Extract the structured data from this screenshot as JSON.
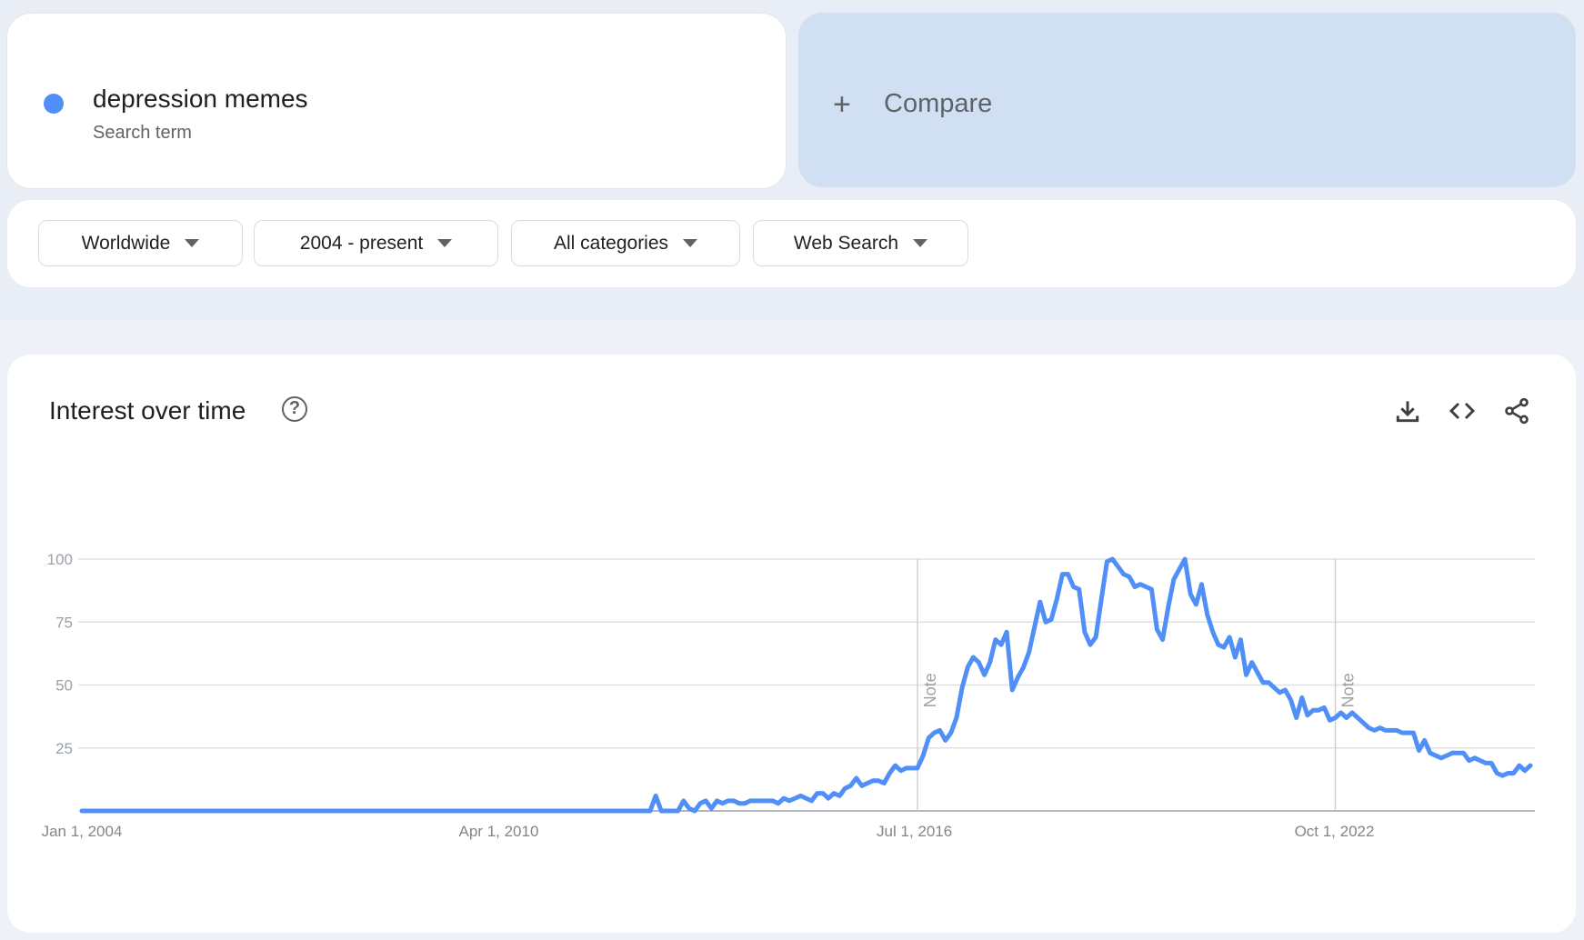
{
  "search_term": {
    "name": "depression memes",
    "subtitle": "Search term",
    "color": "#4f8ff7"
  },
  "compare": {
    "plus_icon": "+",
    "label": "Compare"
  },
  "filters": [
    {
      "label": "Worldwide"
    },
    {
      "label": "2004 - present"
    },
    {
      "label": "All categories"
    },
    {
      "label": "Web Search"
    }
  ],
  "chart_card": {
    "title": "Interest over time",
    "help_icon": "?",
    "actions": [
      "download-icon",
      "embed-code-icon",
      "share-icon"
    ]
  },
  "chart_data": {
    "type": "line",
    "title": "Interest over time",
    "xlabel": "",
    "ylabel": "",
    "ylim": [
      0,
      100
    ],
    "yticks": [
      25,
      50,
      75,
      100
    ],
    "x_start": "2004-01",
    "x_interval": "month",
    "x_tick_labels": [
      {
        "label": "Jan 1, 2004",
        "month_index": 0
      },
      {
        "label": "Apr 1, 2010",
        "month_index": 75
      },
      {
        "label": "Jul 1, 2016",
        "month_index": 150
      },
      {
        "label": "Oct 1, 2022",
        "month_index": 225
      }
    ],
    "annotations": [
      {
        "label": "Note",
        "month_index": 150
      },
      {
        "label": "Note",
        "month_index": 225
      }
    ],
    "grid": true,
    "legend": "none",
    "series": [
      {
        "name": "depression memes",
        "color": "#4f8ff7",
        "values": [
          0,
          0,
          0,
          0,
          0,
          0,
          0,
          0,
          0,
          0,
          0,
          0,
          0,
          0,
          0,
          0,
          0,
          0,
          0,
          0,
          0,
          0,
          0,
          0,
          0,
          0,
          0,
          0,
          0,
          0,
          0,
          0,
          0,
          0,
          0,
          0,
          0,
          0,
          0,
          0,
          0,
          0,
          0,
          0,
          0,
          0,
          0,
          0,
          0,
          0,
          0,
          0,
          0,
          0,
          0,
          0,
          0,
          0,
          0,
          0,
          0,
          0,
          0,
          0,
          0,
          0,
          0,
          0,
          0,
          0,
          0,
          0,
          0,
          0,
          0,
          0,
          0,
          0,
          0,
          0,
          0,
          0,
          0,
          0,
          0,
          0,
          0,
          0,
          0,
          0,
          0,
          0,
          0,
          0,
          0,
          0,
          0,
          0,
          0,
          0,
          0,
          0,
          0,
          6,
          0,
          0,
          0,
          0,
          4,
          1,
          0,
          3,
          4,
          1,
          4,
          3,
          4,
          4,
          3,
          3,
          4,
          4,
          4,
          4,
          4,
          3,
          5,
          4,
          5,
          6,
          5,
          4,
          7,
          7,
          5,
          7,
          6,
          9,
          10,
          13,
          10,
          11,
          12,
          12,
          11,
          15,
          18,
          16,
          17,
          17,
          17,
          22,
          29,
          31,
          32,
          28,
          31,
          37,
          49,
          57,
          61,
          59,
          54,
          59,
          68,
          66,
          71,
          48,
          53,
          57,
          63,
          73,
          83,
          75,
          76,
          84,
          94,
          94,
          89,
          88,
          71,
          66,
          69,
          84,
          99,
          100,
          97,
          94,
          93,
          89,
          90,
          89,
          88,
          72,
          68,
          81,
          92,
          96,
          100,
          86,
          82,
          90,
          78,
          71,
          66,
          65,
          69,
          61,
          68,
          54,
          59,
          55,
          51,
          51,
          49,
          47,
          48,
          44,
          37,
          45,
          38,
          40,
          40,
          41,
          36,
          37,
          39,
          37,
          39,
          37,
          35,
          33,
          32,
          33,
          32,
          32,
          32,
          31,
          31,
          31,
          24,
          28,
          23,
          22,
          21,
          22,
          23,
          23,
          23,
          20,
          21,
          20,
          19,
          19,
          15,
          14,
          15,
          15,
          18,
          16,
          18
        ]
      }
    ]
  }
}
